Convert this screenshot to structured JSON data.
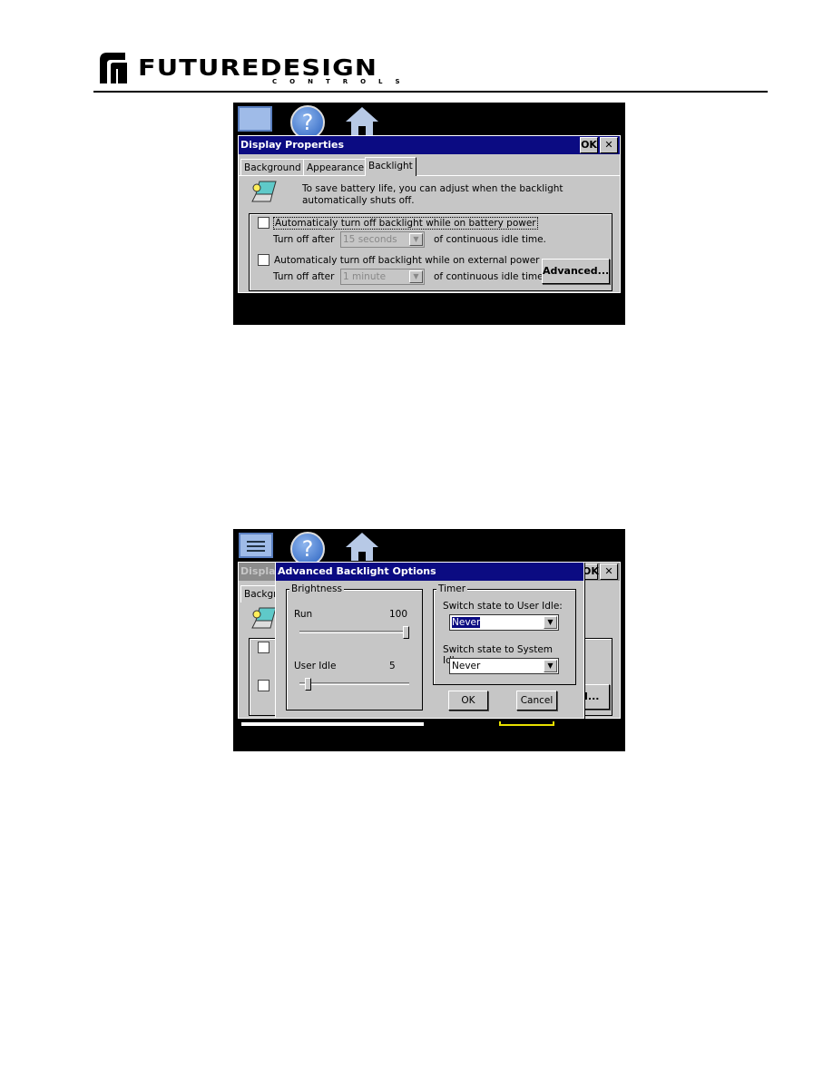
{
  "header": {
    "brand": "FUTUREDESIGN",
    "brand_sub": "CONTROLS"
  },
  "screen1": {
    "taskbar_icons": [
      "monitor-icon",
      "help-icon",
      "home-icon"
    ],
    "dialog": {
      "title": "Display Properties",
      "ok": "OK",
      "close": "✕",
      "tabs": [
        {
          "label": "Background",
          "active": false
        },
        {
          "label": "Appearance",
          "active": false
        },
        {
          "label": "Backlight",
          "active": true
        }
      ],
      "info_line1": "To save battery life, you can adjust when the backlight",
      "info_line2": "automatically shuts off.",
      "battery_label": "Automaticaly turn off backlight while on battery power",
      "battery_checked": false,
      "turn_off_after": "Turn off after",
      "battery_value": "15 seconds",
      "idle_suffix": "of continuous idle time.",
      "external_label": "Automaticaly turn off backlight while on external power",
      "external_checked": false,
      "external_value": "1 minute",
      "advanced": "Advanced..."
    }
  },
  "screen2": {
    "bg_title": "Display",
    "bg_tab": "Backgr",
    "bg_ok": "OK",
    "bg_close": "✕",
    "bg_advanced_fragment": "ed...",
    "dialog": {
      "title": "Advanced Backlight Options",
      "brightness": {
        "label": "Brightness",
        "run_label": "Run",
        "run_value": "100",
        "run_level": 100,
        "idle_label": "User Idle",
        "idle_value": "5",
        "idle_level": 5
      },
      "timer": {
        "label": "Timer",
        "user_idle_label": "Switch state to User Idle:",
        "user_idle_value": "Never",
        "system_idle_label": "Switch state to System Idle:",
        "system_idle_value": "Never"
      },
      "ok": "OK",
      "cancel": "Cancel"
    }
  },
  "colors": {
    "title_bar": "#0b0b82",
    "window": "#c6c6c6"
  }
}
